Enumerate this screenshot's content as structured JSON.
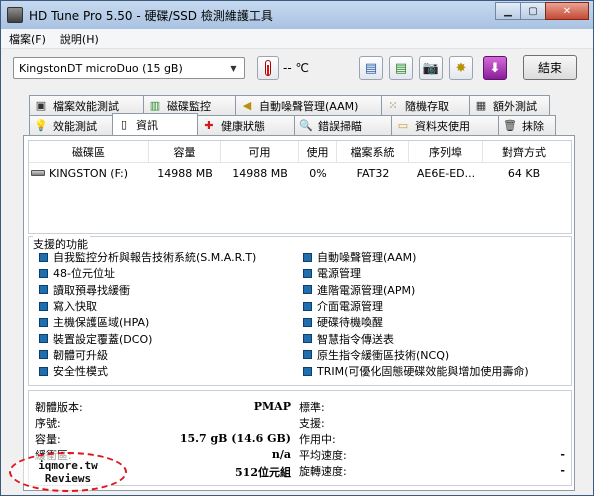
{
  "window": {
    "title": "HD Tune Pro 5.50 - 硬碟/SSD 檢測維護工具"
  },
  "menu": [
    {
      "label": "檔案(F)"
    },
    {
      "label": "說明(H)"
    }
  ],
  "toolbar": {
    "drive": "KingstonDT microDuo (15 gB)",
    "temperature": "-- ℃",
    "exit_label": "結束"
  },
  "tabs_top": [
    {
      "label": "檔案效能測試",
      "icon": "file-benchmark-icon"
    },
    {
      "label": "磁碟監控",
      "icon": "disk-monitor-icon"
    },
    {
      "label": "自動噪聲管理(AAM)",
      "icon": "speaker-icon"
    },
    {
      "label": "隨機存取",
      "icon": "random-access-icon"
    },
    {
      "label": "額外測試",
      "icon": "extra-tests-icon"
    }
  ],
  "tabs_bottom": [
    {
      "label": "效能測試",
      "icon": "lightbulb-icon"
    },
    {
      "label": "資訊",
      "icon": "info-icon"
    },
    {
      "label": "健康狀態",
      "icon": "health-cross-icon"
    },
    {
      "label": "錯誤掃瞄",
      "icon": "magnifier-icon"
    },
    {
      "label": "資料夾使用",
      "icon": "folder-icon"
    },
    {
      "label": "抹除",
      "icon": "trash-icon"
    }
  ],
  "active_tab": "資訊",
  "drive_table": {
    "headers": [
      "磁碟區",
      "容量",
      "可用",
      "使用",
      "檔案系統",
      "序列埠",
      "對齊方式"
    ],
    "rows": [
      [
        "KINGSTON (F:)",
        "14988 MB",
        "14988 MB",
        "0%",
        "FAT32",
        "AE6E-ED...",
        "64 KB"
      ]
    ]
  },
  "features": {
    "title": "支援的功能",
    "left": [
      "自我監控分析與報告技術系統(S.M.A.R.T)",
      "48-位元位址",
      "讀取預尋找緩衝",
      "寫入快取",
      "主機保護區域(HPA)",
      "裝置設定覆蓋(DCO)",
      "韌體可升級",
      "安全性模式"
    ],
    "right": [
      "自動噪聲管理(AAM)",
      "電源管理",
      "進階電源管理(APM)",
      "介面電源管理",
      "硬碟待機喚醒",
      "智慧指令傳送表",
      "原生指令緩衝區技術(NCQ)",
      "TRIM(可優化固態硬碟效能與增加使用壽命)"
    ]
  },
  "info": {
    "left": [
      {
        "label": "韌體版本:",
        "value": "PMAP"
      },
      {
        "label": "序號:",
        "value": ""
      },
      {
        "label": "容量:",
        "value": "15.7 gB (14.6 GB)"
      },
      {
        "label": "緩衝區:",
        "value": "n/a"
      },
      {
        "label": "",
        "value": "512位元組"
      }
    ],
    "right": [
      {
        "label": "標準:",
        "value": ""
      },
      {
        "label": "支援:",
        "value": ""
      },
      {
        "label": "作用中:",
        "value": ""
      },
      {
        "label": "平均速度:",
        "value": "-"
      },
      {
        "label": "旋轉速度:",
        "value": "-"
      }
    ]
  },
  "watermark": {
    "line1": "iqmore.tw",
    "line2": "Reviews"
  }
}
